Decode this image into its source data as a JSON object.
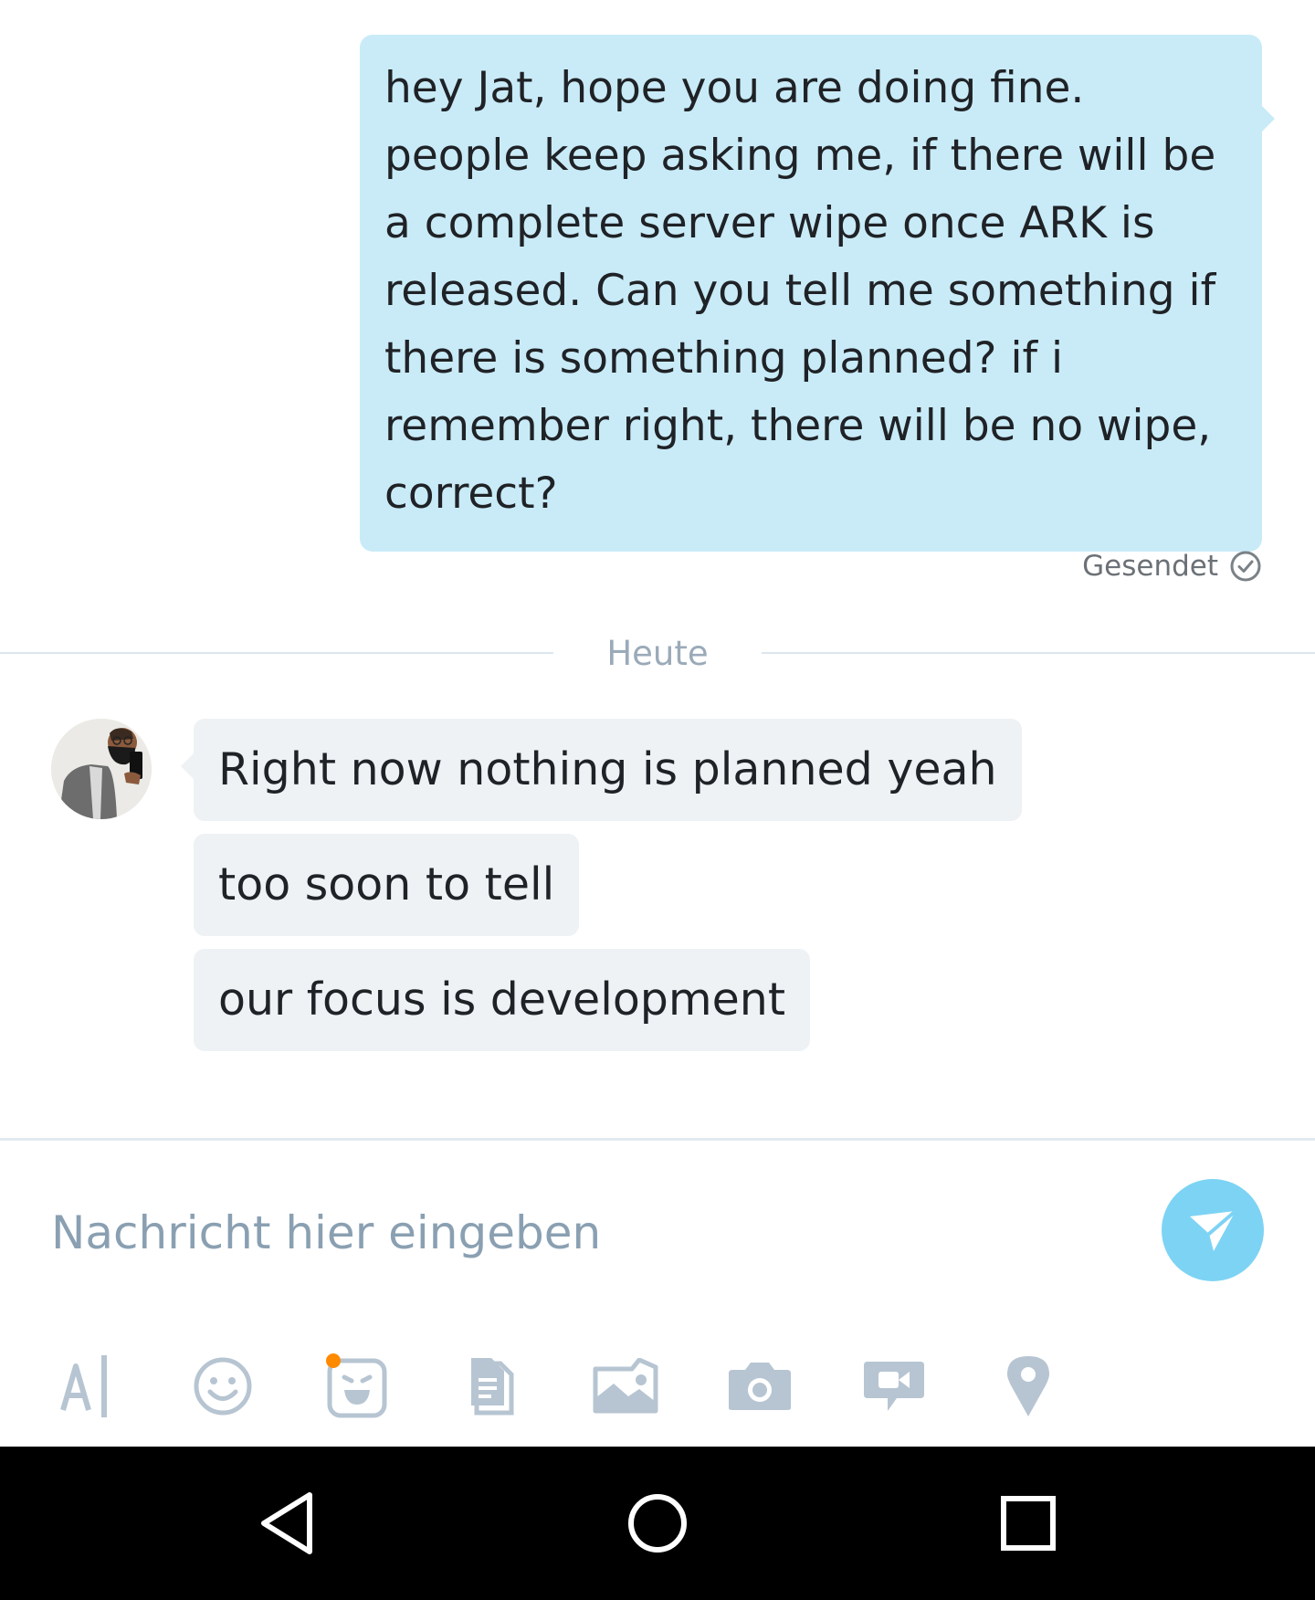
{
  "conversation": {
    "outgoing": {
      "text": "hey Jat, hope you are doing fine. people keep asking me, if there will be a complete server wipe once ARK is released. Can you tell me something if there is something planned? if i remember right, there will be no wipe, correct?",
      "status": "Gesendet"
    },
    "date_divider": "Heute",
    "incoming": [
      {
        "text": "Right now nothing is planned yeah"
      },
      {
        "text": "too soon to tell"
      },
      {
        "text": "our focus is development"
      }
    ]
  },
  "composer": {
    "placeholder": "Nachricht hier eingeben",
    "toolbar_icons": [
      "text-format-icon",
      "emoji-icon",
      "sticker-icon",
      "file-icon",
      "image-gallery-icon",
      "camera-icon",
      "video-message-icon",
      "location-icon"
    ]
  },
  "colors": {
    "outgoing_bubble": "#c9ebf8",
    "incoming_bubble": "#eef2f5",
    "send_button": "#7dd3f4",
    "icon": "#b7c5d2",
    "sticker_badge": "#ff8a00"
  },
  "system_nav": [
    "back-icon",
    "home-icon",
    "recents-icon"
  ]
}
